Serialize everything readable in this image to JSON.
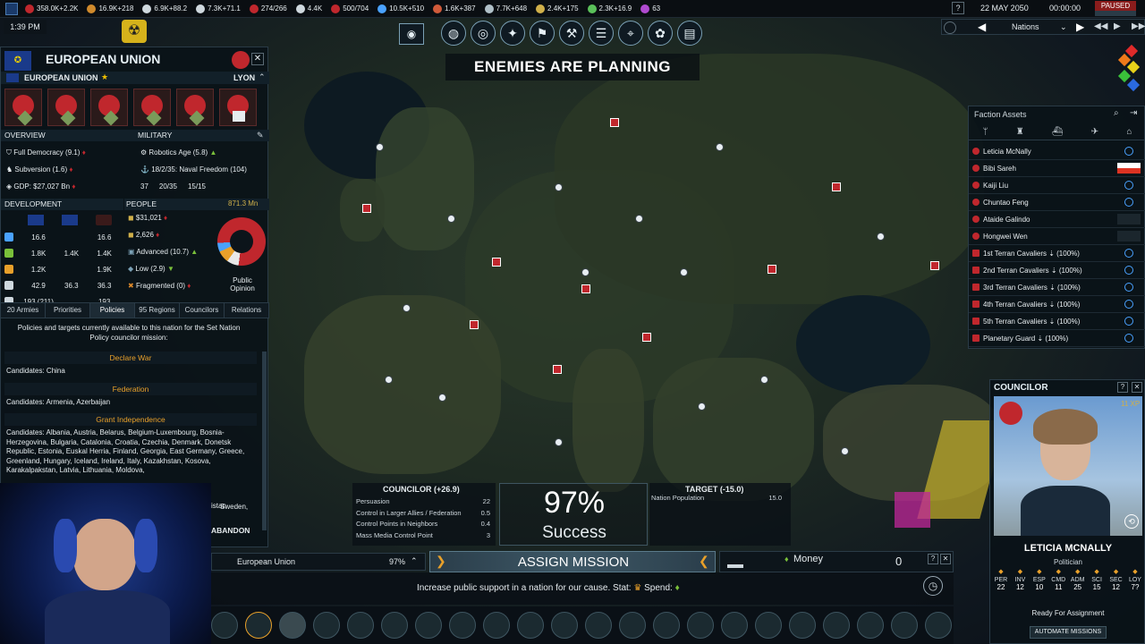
{
  "topbar": {
    "resources": [
      {
        "name": "influence-icon",
        "value": "358.0K+2.2K",
        "color": "#c0272d"
      },
      {
        "name": "operations-icon",
        "value": "16.9K+218",
        "color": "#d08a2c"
      },
      {
        "name": "boost-icon",
        "value": "6.9K+88.2",
        "color": "#cfd8de"
      },
      {
        "name": "mission-control-icon",
        "value": "7.3K+71.1",
        "color": "#cfd8de"
      },
      {
        "name": "research-icon",
        "value": "274/266",
        "color": "#c0272d"
      },
      {
        "name": "projects-icon",
        "value": "4.4K",
        "color": "#cfd8de"
      },
      {
        "name": "faction-icon",
        "value": "500/704",
        "color": "#c0272d"
      },
      {
        "name": "water-icon",
        "value": "10.5K+510",
        "color": "#4aa2ff"
      },
      {
        "name": "volatiles-icon",
        "value": "1.6K+387",
        "color": "#d05a3a"
      },
      {
        "name": "metals-icon",
        "value": "7.7K+648",
        "color": "#b0c0c8"
      },
      {
        "name": "noble-icon",
        "value": "2.4K+175",
        "color": "#d0b04a"
      },
      {
        "name": "fissiles-icon",
        "value": "2.3K+16.9",
        "color": "#5ac05a"
      },
      {
        "name": "antimatter-icon",
        "value": "63",
        "color": "#b04ad0"
      }
    ],
    "help": "?",
    "date": "22 MAY 2050",
    "time": "00:00:00",
    "paused": "PAUSED",
    "clock": "1:39 PM",
    "nations_dropdown": "Nations"
  },
  "banner": "ENEMIES ARE PLANNING",
  "nation": {
    "title": "EUROPEAN UNION",
    "subtitle": "EUROPEAN UNION",
    "capital": "LYON",
    "overview_label": "OVERVIEW",
    "military_label": "MILITARY",
    "overview": [
      "Full Democracy (9.1)",
      "Subversion (1.6)",
      "GDP: $27,027 Bn"
    ],
    "military": [
      "Robotics Age (5.8)",
      "18/2/35: Naval Freedom (104)"
    ],
    "mil_counts": [
      "37",
      "20/35",
      "15/15"
    ],
    "development_label": "DEVELOPMENT",
    "people_label": "PEOPLE",
    "population": "871.3 Mn",
    "dev_rows": [
      [
        "16.6",
        "",
        "16.6"
      ],
      [
        "1.8K",
        "1.4K",
        "1.4K"
      ],
      [
        "1.2K",
        "",
        "1.9K"
      ],
      [
        "42.9",
        "36.3",
        "36.3"
      ],
      [
        "193 (211)",
        "",
        "193"
      ]
    ],
    "people": [
      "$31,021",
      "2,626",
      "Advanced (10.7)",
      "Low (2.9)",
      "Fragmented (0)"
    ],
    "public_opinion": "Public Opinion",
    "tabs": [
      "20 Armies",
      "Priorities",
      "Policies",
      "95 Regions",
      "Councilors",
      "Relations"
    ],
    "policies_intro": "Policies and targets currently available to this nation for the Set Nation Policy councilor mission:",
    "policies": [
      {
        "title": "Declare War",
        "candidates": "Candidates: China"
      },
      {
        "title": "Federation",
        "candidates": "Candidates: Armenia, Azerbaijan"
      },
      {
        "title": "Grant Independence",
        "candidates": "Candidates: Albania, Austria, Belarus, Belgium-Luxembourg, Bosnia-Herzegovina, Bulgaria, Catalonia, Croatia, Czechia, Denmark, Donetsk Republic, Estonia, Euskal Herria, Finland, Georgia, East Germany, Greece, Greenland, Hungary, Iceland, Ireland, Italy, Kazakhstan, Kosova, Karakalpakstan, Latvia, Lithuania, Moldova,"
      }
    ],
    "partial_1": "istan",
    "partial_2": "Sweden,"
  },
  "assets": {
    "title": "Faction Assets",
    "rows": [
      "Leticia McNally",
      "Bibi Sareh",
      "Kaiji Liu",
      "Chuntao Feng",
      "Ataide Galindo",
      "Hongwei Wen",
      "1st Terran Cavaliers ⇣ (100%)",
      "2nd Terran Cavaliers ⇣ (100%)",
      "3rd Terran Cavaliers ⇣ (100%)",
      "4th Terran Cavaliers ⇣ (100%)",
      "5th Terran Cavaliers ⇣ (100%)",
      "Planetary Guard ⇣ (100%)"
    ]
  },
  "councilor": {
    "title": "COUNCILOR",
    "xp": "11 XP",
    "name": "LETICIA MCNALLY",
    "role": "Politician",
    "stats": [
      {
        "k": "PER",
        "v": "22"
      },
      {
        "k": "INV",
        "v": "12"
      },
      {
        "k": "ESP",
        "v": "10"
      },
      {
        "k": "CMD",
        "v": "11"
      },
      {
        "k": "ADM",
        "v": "25"
      },
      {
        "k": "SCI",
        "v": "15"
      },
      {
        "k": "SEC",
        "v": "12"
      },
      {
        "k": "LOY",
        "v": "7?"
      }
    ],
    "status": "Ready For Assignment",
    "automate": "AUTOMATE MISSIONS"
  },
  "mission": {
    "councilor_header": "COUNCILOR (+26.9)",
    "target_header": "TARGET (-15.0)",
    "councilor_rows": [
      {
        "k": "Persuasion",
        "v": "22"
      },
      {
        "k": "Control in Larger Allies / Federation",
        "v": "0.5"
      },
      {
        "k": "Control Points in Neighbors",
        "v": "0.4"
      },
      {
        "k": "Mass Media Control Point",
        "v": "3"
      }
    ],
    "target_rows": [
      {
        "k": "Nation Population",
        "v": "15.0"
      }
    ],
    "percent": "97%",
    "result": "Success",
    "abandon": "ABANDON",
    "nation_name": "European Union",
    "nation_pct": "97%",
    "assign": "ASSIGN MISSION",
    "money_label": "Money",
    "money_value": "0",
    "description": "Increase public support in a nation for our cause. Stat:",
    "spend": "Spend:"
  }
}
